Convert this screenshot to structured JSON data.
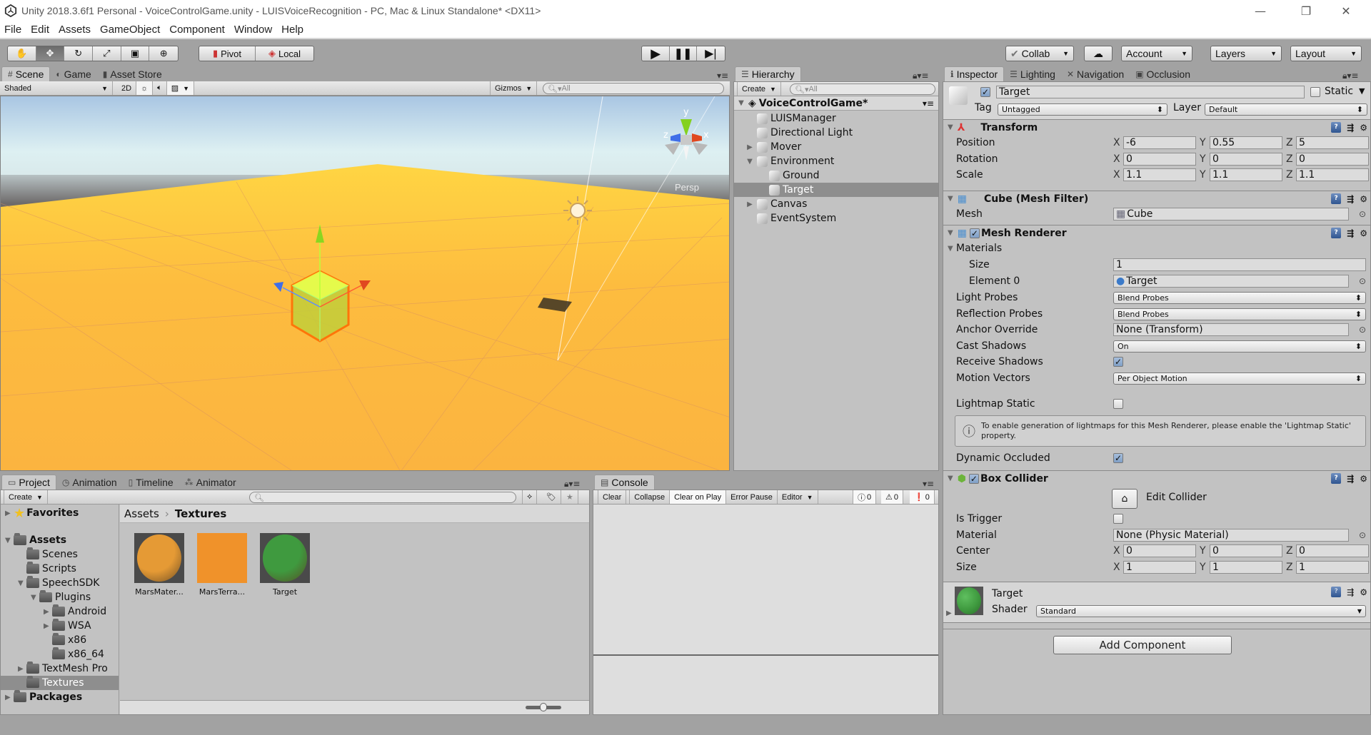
{
  "window": {
    "title": "Unity 2018.3.6f1 Personal - VoiceControlGame.unity - LUISVoiceRecognition - PC, Mac & Linux Standalone* <DX11>",
    "controls": [
      "minimize",
      "restore",
      "close"
    ]
  },
  "menu": [
    "File",
    "Edit",
    "Assets",
    "GameObject",
    "Component",
    "Window",
    "Help"
  ],
  "toolbar": {
    "tools": [
      "hand-tool",
      "move-tool",
      "rotate-tool",
      "scale-tool",
      "rect-tool",
      "transform-tool"
    ],
    "active_tool": "move-tool",
    "pivot_label": "Pivot",
    "local_label": "Local",
    "collab_label": "Collab",
    "account_label": "Account",
    "layers_label": "Layers",
    "layout_label": "Layout"
  },
  "scene_panel": {
    "tabs": [
      {
        "label": "Scene",
        "icon": "#",
        "active": true
      },
      {
        "label": "Game",
        "icon": "◐",
        "active": false
      },
      {
        "label": "Asset Store",
        "icon": "▮",
        "active": false
      }
    ],
    "shading_mode": "Shaded",
    "mode_2d": "2D",
    "gizmos_label": "Gizmos",
    "search_placeholder": "All",
    "projection_label": "Persp",
    "axis_labels": {
      "x": "x",
      "y": "y",
      "z": "z"
    }
  },
  "hierarchy": {
    "tab_label": "Hierarchy",
    "create_label": "Create",
    "search_placeholder": "All",
    "scene_name": "VoiceControlGame*",
    "items": [
      {
        "label": "LUISManager",
        "depth": 0,
        "fold": "none",
        "selected": false
      },
      {
        "label": "Directional Light",
        "depth": 0,
        "fold": "none",
        "selected": false
      },
      {
        "label": "Mover",
        "depth": 0,
        "fold": "collapsed",
        "selected": false
      },
      {
        "label": "Environment",
        "depth": 0,
        "fold": "expanded",
        "selected": false
      },
      {
        "label": "Ground",
        "depth": 1,
        "fold": "none",
        "selected": false
      },
      {
        "label": "Target",
        "depth": 1,
        "fold": "none",
        "selected": true
      },
      {
        "label": "Canvas",
        "depth": 0,
        "fold": "collapsed",
        "selected": false
      },
      {
        "label": "EventSystem",
        "depth": 0,
        "fold": "none",
        "selected": false
      }
    ]
  },
  "inspector": {
    "tabs": [
      {
        "label": "Inspector",
        "icon": "ℹ",
        "active": true
      },
      {
        "label": "Lighting",
        "icon": "☰",
        "active": false
      },
      {
        "label": "Navigation",
        "icon": "✕",
        "active": false
      },
      {
        "label": "Occlusion",
        "icon": "▣",
        "active": false
      }
    ],
    "object": {
      "active": true,
      "name": "Target",
      "static_label": "Static",
      "static": false,
      "tag_label": "Tag",
      "tag": "Untagged",
      "layer_label": "Layer",
      "layer": "Default"
    },
    "transform": {
      "title": "Transform",
      "position_label": "Position",
      "rotation_label": "Rotation",
      "scale_label": "Scale",
      "position": {
        "x": "-6",
        "y": "0.55",
        "z": "5"
      },
      "rotation": {
        "x": "0",
        "y": "0",
        "z": "0"
      },
      "scale": {
        "x": "1.1",
        "y": "1.1",
        "z": "1.1"
      }
    },
    "mesh_filter": {
      "title": "Cube (Mesh Filter)",
      "mesh_label": "Mesh",
      "mesh": "Cube"
    },
    "mesh_renderer": {
      "title": "Mesh Renderer",
      "enabled": true,
      "materials_label": "Materials",
      "size_label": "Size",
      "size": "1",
      "element0_label": "Element 0",
      "element0": "Target",
      "light_probes_label": "Light Probes",
      "light_probes": "Blend Probes",
      "reflection_probes_label": "Reflection Probes",
      "reflection_probes": "Blend Probes",
      "anchor_override_label": "Anchor Override",
      "anchor_override": "None (Transform)",
      "cast_shadows_label": "Cast Shadows",
      "cast_shadows": "On",
      "receive_shadows_label": "Receive Shadows",
      "receive_shadows": true,
      "motion_vectors_label": "Motion Vectors",
      "motion_vectors": "Per Object Motion",
      "lightmap_static_label": "Lightmap Static",
      "lightmap_static": false,
      "info_message": "To enable generation of lightmaps for this Mesh Renderer, please enable the 'Lightmap Static' property.",
      "dynamic_occluded_label": "Dynamic Occluded",
      "dynamic_occluded": true
    },
    "box_collider": {
      "title": "Box Collider",
      "enabled": true,
      "edit_collider_label": "Edit Collider",
      "is_trigger_label": "Is Trigger",
      "is_trigger": false,
      "material_label": "Material",
      "material": "None (Physic Material)",
      "center_label": "Center",
      "center": {
        "x": "0",
        "y": "0",
        "z": "0"
      },
      "size_label": "Size",
      "size": {
        "x": "1",
        "y": "1",
        "z": "1"
      }
    },
    "material": {
      "name": "Target",
      "shader_label": "Shader",
      "shader": "Standard",
      "color": "#3f9a3f"
    },
    "add_component_label": "Add Component"
  },
  "project": {
    "tabs": [
      {
        "label": "Project",
        "icon": "▭",
        "active": true
      },
      {
        "label": "Animation",
        "icon": "◷",
        "active": false
      },
      {
        "label": "Timeline",
        "icon": "▯",
        "active": false
      },
      {
        "label": "Animator",
        "icon": "⁂",
        "active": false
      }
    ],
    "create_label": "Create",
    "search_placeholder": "",
    "breadcrumb": [
      "Assets",
      "Textures"
    ],
    "tree": [
      {
        "label": "Favorites",
        "depth": 0,
        "fold": "collapsed",
        "bold": true,
        "icon": "star",
        "selected": false
      },
      {
        "label": "Assets",
        "depth": 0,
        "fold": "expanded",
        "bold": true,
        "icon": "folder",
        "selected": false
      },
      {
        "label": "Scenes",
        "depth": 1,
        "fold": "none",
        "bold": false,
        "icon": "folder",
        "selected": false
      },
      {
        "label": "Scripts",
        "depth": 1,
        "fold": "none",
        "bold": false,
        "icon": "folder",
        "selected": false
      },
      {
        "label": "SpeechSDK",
        "depth": 1,
        "fold": "expanded",
        "bold": false,
        "icon": "folder",
        "selected": false
      },
      {
        "label": "Plugins",
        "depth": 2,
        "fold": "expanded",
        "bold": false,
        "icon": "folder",
        "selected": false
      },
      {
        "label": "Android",
        "depth": 3,
        "fold": "collapsed",
        "bold": false,
        "icon": "folder",
        "selected": false
      },
      {
        "label": "WSA",
        "depth": 3,
        "fold": "collapsed",
        "bold": false,
        "icon": "folder",
        "selected": false
      },
      {
        "label": "x86",
        "depth": 3,
        "fold": "none",
        "bold": false,
        "icon": "folder",
        "selected": false
      },
      {
        "label": "x86_64",
        "depth": 3,
        "fold": "none",
        "bold": false,
        "icon": "folder",
        "selected": false
      },
      {
        "label": "TextMesh Pro",
        "depth": 1,
        "fold": "collapsed",
        "bold": false,
        "icon": "folder",
        "selected": false
      },
      {
        "label": "Textures",
        "depth": 1,
        "fold": "none",
        "bold": false,
        "icon": "folder",
        "selected": true
      },
      {
        "label": "Packages",
        "depth": 0,
        "fold": "collapsed",
        "bold": true,
        "icon": "folder",
        "selected": false
      }
    ],
    "assets": [
      {
        "label": "MarsMater...",
        "kind": "material-sphere",
        "color": "#e59a35"
      },
      {
        "label": "MarsTerra...",
        "kind": "texture",
        "color": "#f0922a"
      },
      {
        "label": "Target",
        "kind": "material-sphere",
        "color": "#3f9a3f"
      }
    ],
    "thumb_size_slider": 0.5
  },
  "console": {
    "tab_label": "Console",
    "buttons": [
      "Clear",
      "Collapse",
      "Clear on Play",
      "Error Pause",
      "Editor"
    ],
    "active_buttons": [
      "Clear on Play"
    ],
    "info_count": "0",
    "warning_count": "0",
    "error_count": "0"
  }
}
